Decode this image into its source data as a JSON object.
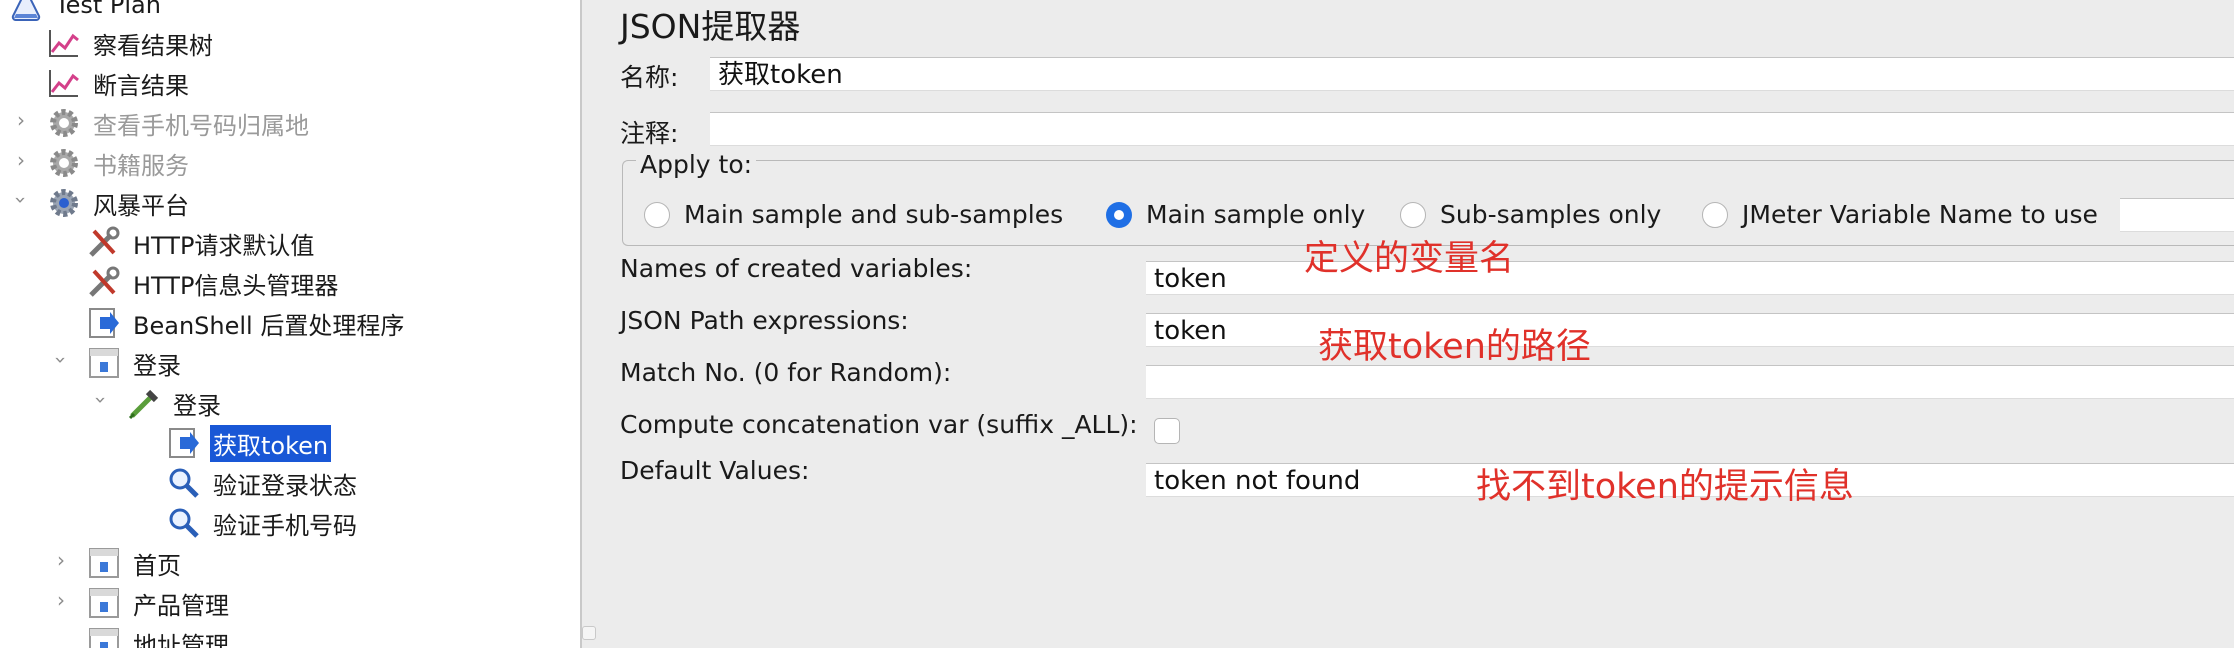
{
  "tree": {
    "root": "Test Plan",
    "items": [
      {
        "label": "察看结果树",
        "icon": "listener-chart-icon"
      },
      {
        "label": "断言结果",
        "icon": "listener-chart-icon"
      },
      {
        "label": "查看手机号码归属地",
        "icon": "gear-icon"
      },
      {
        "label": "书籍服务",
        "icon": "gear-icon"
      },
      {
        "label": "风暴平台",
        "icon": "gear-icon"
      },
      {
        "label": "HTTP请求默认值",
        "icon": "wrench-icon"
      },
      {
        "label": "HTTP信息头管理器",
        "icon": "wrench-icon"
      },
      {
        "label": "BeanShell 后置处理程序",
        "icon": "postprocessor-icon"
      },
      {
        "label": "登录",
        "icon": "controller-icon"
      },
      {
        "label": "登录",
        "icon": "sampler-pipette-icon"
      },
      {
        "label": "获取token",
        "icon": "postprocessor-icon"
      },
      {
        "label": "验证登录状态",
        "icon": "magnifier-icon"
      },
      {
        "label": "验证手机号码",
        "icon": "magnifier-icon"
      },
      {
        "label": "首页",
        "icon": "controller-icon"
      },
      {
        "label": "产品管理",
        "icon": "controller-icon"
      },
      {
        "label": "地址管理",
        "icon": "controller-icon"
      }
    ]
  },
  "panel": {
    "title": "JSON提取器",
    "name_label": "名称:",
    "name_value": "获取token",
    "comment_label": "注释:",
    "comment_value": "",
    "apply_to": {
      "legend": "Apply to:",
      "options": [
        "Main sample and sub-samples",
        "Main sample only",
        "Sub-samples only",
        "JMeter Variable Name to use"
      ],
      "selected": "Main sample only",
      "variable_value": ""
    },
    "fields": {
      "names_label": "Names of created variables:",
      "names_value": "token",
      "paths_label": "JSON Path expressions:",
      "paths_value": "token",
      "match_label": "Match No. (0 for Random):",
      "match_value": "",
      "concat_label": "Compute concatenation var (suffix _ALL):",
      "default_label": "Default Values:",
      "default_value": "token not found"
    }
  },
  "annotations": {
    "var_name": "定义的变量名",
    "path": "获取token的路径",
    "default": "找不到token的提示信息"
  },
  "colors": {
    "annotation": "#e0312a",
    "selection": "#1957d6",
    "radio_selected": "#1f6fe5"
  }
}
